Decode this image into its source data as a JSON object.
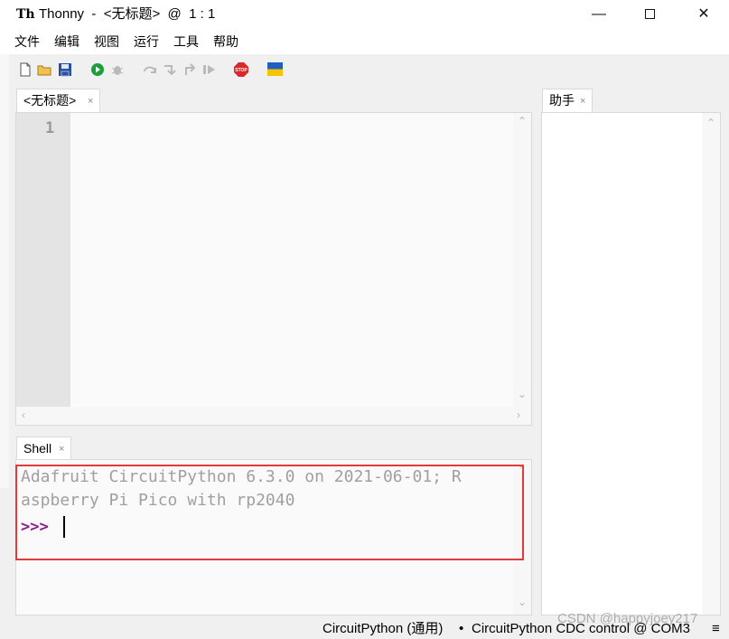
{
  "window": {
    "logo": "Th",
    "title": "Thonny  -  <无标题>  @  1 : 1",
    "controls": {
      "minimize": "—",
      "close": "✕"
    }
  },
  "menu": [
    "文件",
    "编辑",
    "视图",
    "运行",
    "工具",
    "帮助"
  ],
  "toolbar": {
    "icons": [
      "new-file-icon",
      "open-folder-icon",
      "save-icon",
      "run-icon",
      "debug-icon",
      "step-over-icon",
      "step-into-icon",
      "step-out-icon",
      "resume-icon",
      "stop-icon",
      "ukraine-flag-icon"
    ],
    "stop_label": "STOP",
    "colors": {
      "run": "#1e9e3a",
      "stop": "#d62b2b",
      "flag_blue": "#1f5fbf",
      "flag_yellow": "#f5c400"
    }
  },
  "editor": {
    "tab_label": "<无标题>",
    "line_numbers": [
      "1"
    ]
  },
  "shell": {
    "tab_label": "Shell",
    "output": "Adafruit CircuitPython 6.3.0 on 2021-06-01; R\naspberry Pi Pico with rp2040",
    "prompt": ">>>",
    "highlight_color": "#e03a3a"
  },
  "assistant": {
    "tab_label": "助手"
  },
  "statusbar": {
    "interpreter": "CircuitPython (通用)",
    "separator": "•",
    "port": "CircuitPython CDC control @ COM3",
    "menu_glyph": "≡"
  },
  "watermark": "CSDN @happyjoey217"
}
